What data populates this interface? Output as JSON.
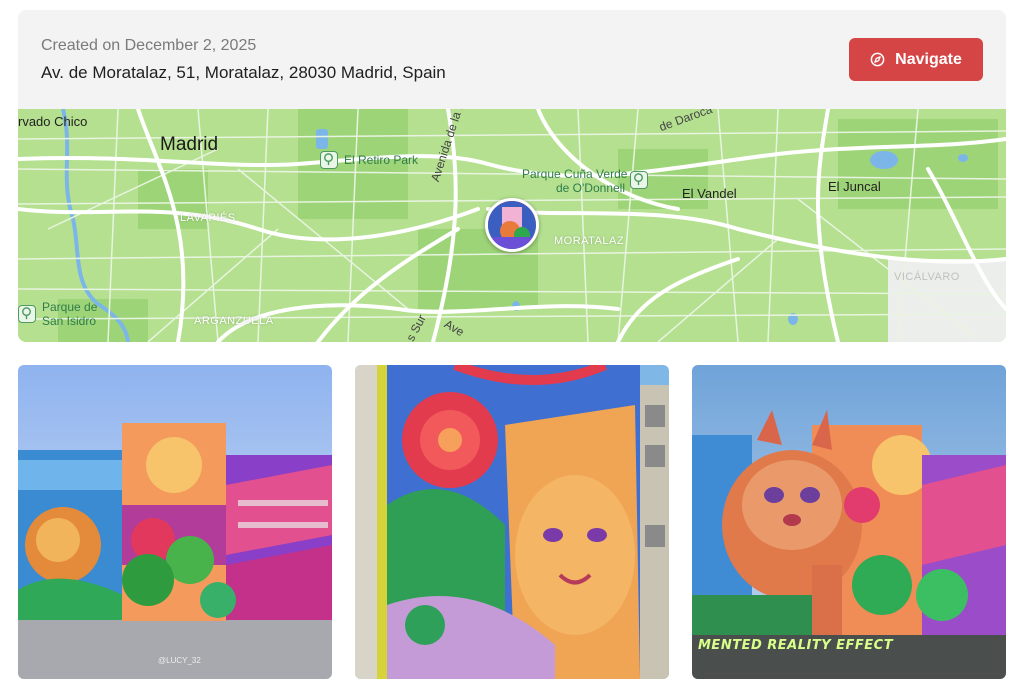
{
  "header": {
    "created": "Created on December 2, 2025",
    "address": "Av. de Moratalaz, 51, Moratalaz, 28030 Madrid, Spain",
    "navigate_label": "Navigate",
    "navigate_icon": "compass-icon",
    "accent_color": "#d64545"
  },
  "map": {
    "labels": {
      "corvado": "rvado Chico",
      "madrid": "Madrid",
      "retiro": "El Retiro Park",
      "cuna_line1": "Parque Cuña Verde",
      "cuna_line2": "de O'Donnell",
      "vandel": "El Vandel",
      "juncal": "El Juncal",
      "lavapies": "LAVAPIÉS",
      "moratalaz": "MORATALAZ",
      "vicalvaro": "VICÁLVARO",
      "san_isidro_line1": "Parque de",
      "san_isidro_line2": "San Isidro",
      "arganzuela": "ARGANZUELA",
      "avenida_paz": "Avenida de la Paz",
      "daroca": "de Daroca",
      "sur": "s Sur",
      "ave": "Ave"
    },
    "land_color": "#a8dc86",
    "road_color": "#ffffff",
    "water_color": "#7cb6e8"
  },
  "photos": {
    "watermark": "@LUCY_32",
    "ar_caption": "MENTED REALITY EFFECT"
  }
}
